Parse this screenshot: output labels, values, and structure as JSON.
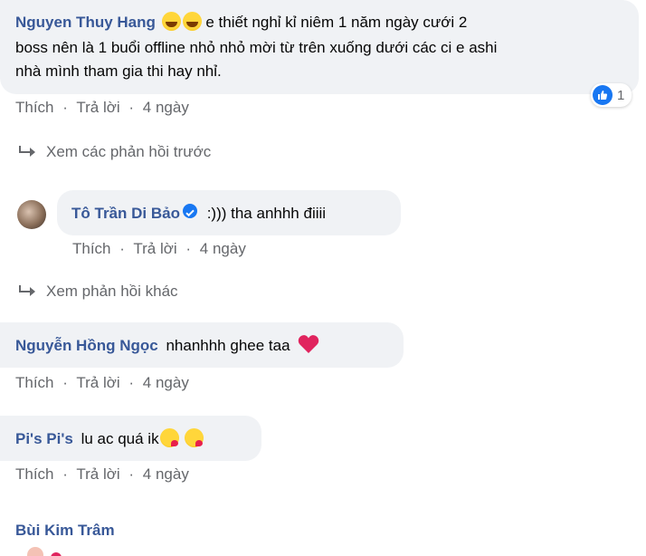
{
  "comments": [
    {
      "author": "Nguyen Thuy Hang",
      "text_line1": "e thiết nghỉ kỉ niêm 1 năm ngày cưới 2",
      "text_line2": "boss nên là 1 buổi offline nhỏ nhỏ mời từ trên xuống dưới các ci e ashi",
      "text_line3": "nhà mình tham gia thi hay nhỉ.",
      "emojis": [
        "rolling-on-floor-laughing",
        "rolling-on-floor-laughing"
      ],
      "like_count": "1"
    },
    {
      "author": "Tô Trần Di Bảo",
      "verified": true,
      "text": ":))) tha anhhh điiii"
    },
    {
      "author": "Nguyễn Hồng Ngọc",
      "text": "nhanhhh ghee taa",
      "emoji": "red-heart"
    },
    {
      "author": "Pi's Pi's",
      "text": "lu ac quá ik",
      "emojis": [
        "face-blowing-kiss",
        "face-blowing-kiss"
      ]
    },
    {
      "author": "Bùi Kim Trâm"
    }
  ],
  "actions": {
    "like": "Thích",
    "reply": "Trả lời",
    "sep": "·",
    "age": "4 ngày"
  },
  "links": {
    "previous_replies": "Xem các phản hồi trước",
    "other_replies": "Xem phản hồi khác"
  },
  "colors": {
    "name": "#385898",
    "bubble": "#f0f2f5",
    "meta": "#65676b",
    "like_blue": "#1877f2",
    "heart": "#e0245e"
  }
}
